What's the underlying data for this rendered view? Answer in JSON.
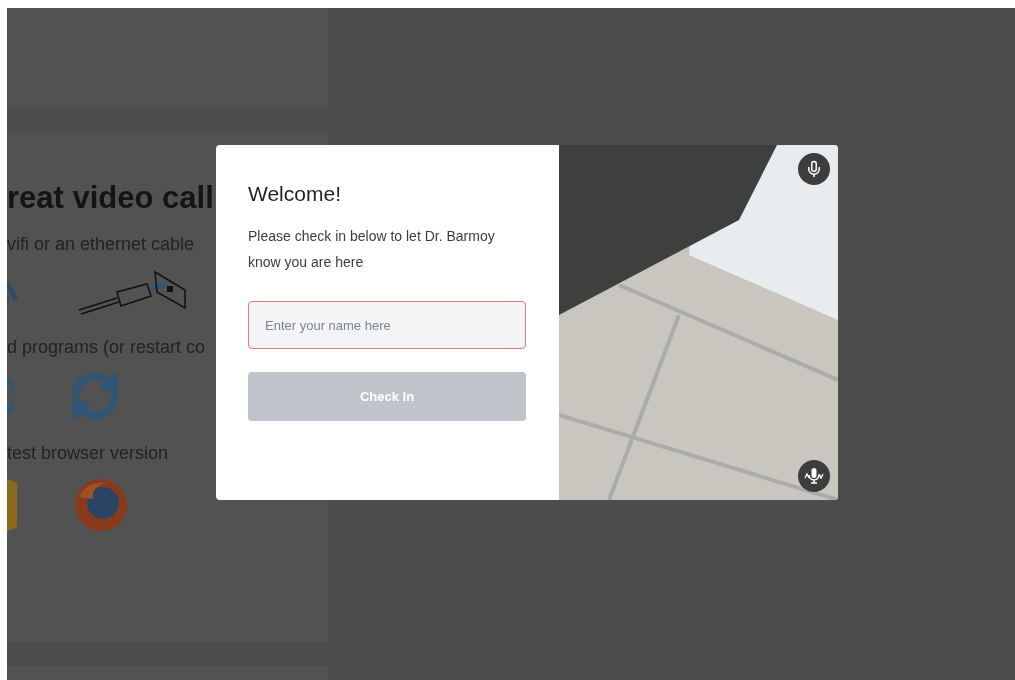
{
  "background": {
    "heading": "reat video call",
    "sections": [
      {
        "text": "vifi or an ethernet cable"
      },
      {
        "text": "d programs (or restart co"
      },
      {
        "text": "test browser version"
      }
    ]
  },
  "modal": {
    "title": "Welcome!",
    "message": "Please check in below to let Dr. Barmoy know you are here",
    "name_field": {
      "placeholder": "Enter your name here",
      "invalid": true
    },
    "check_in_button": {
      "label": "Check In",
      "disabled": true
    },
    "video_controls": [
      {
        "kind": "mic"
      },
      {
        "kind": "switch"
      }
    ]
  }
}
